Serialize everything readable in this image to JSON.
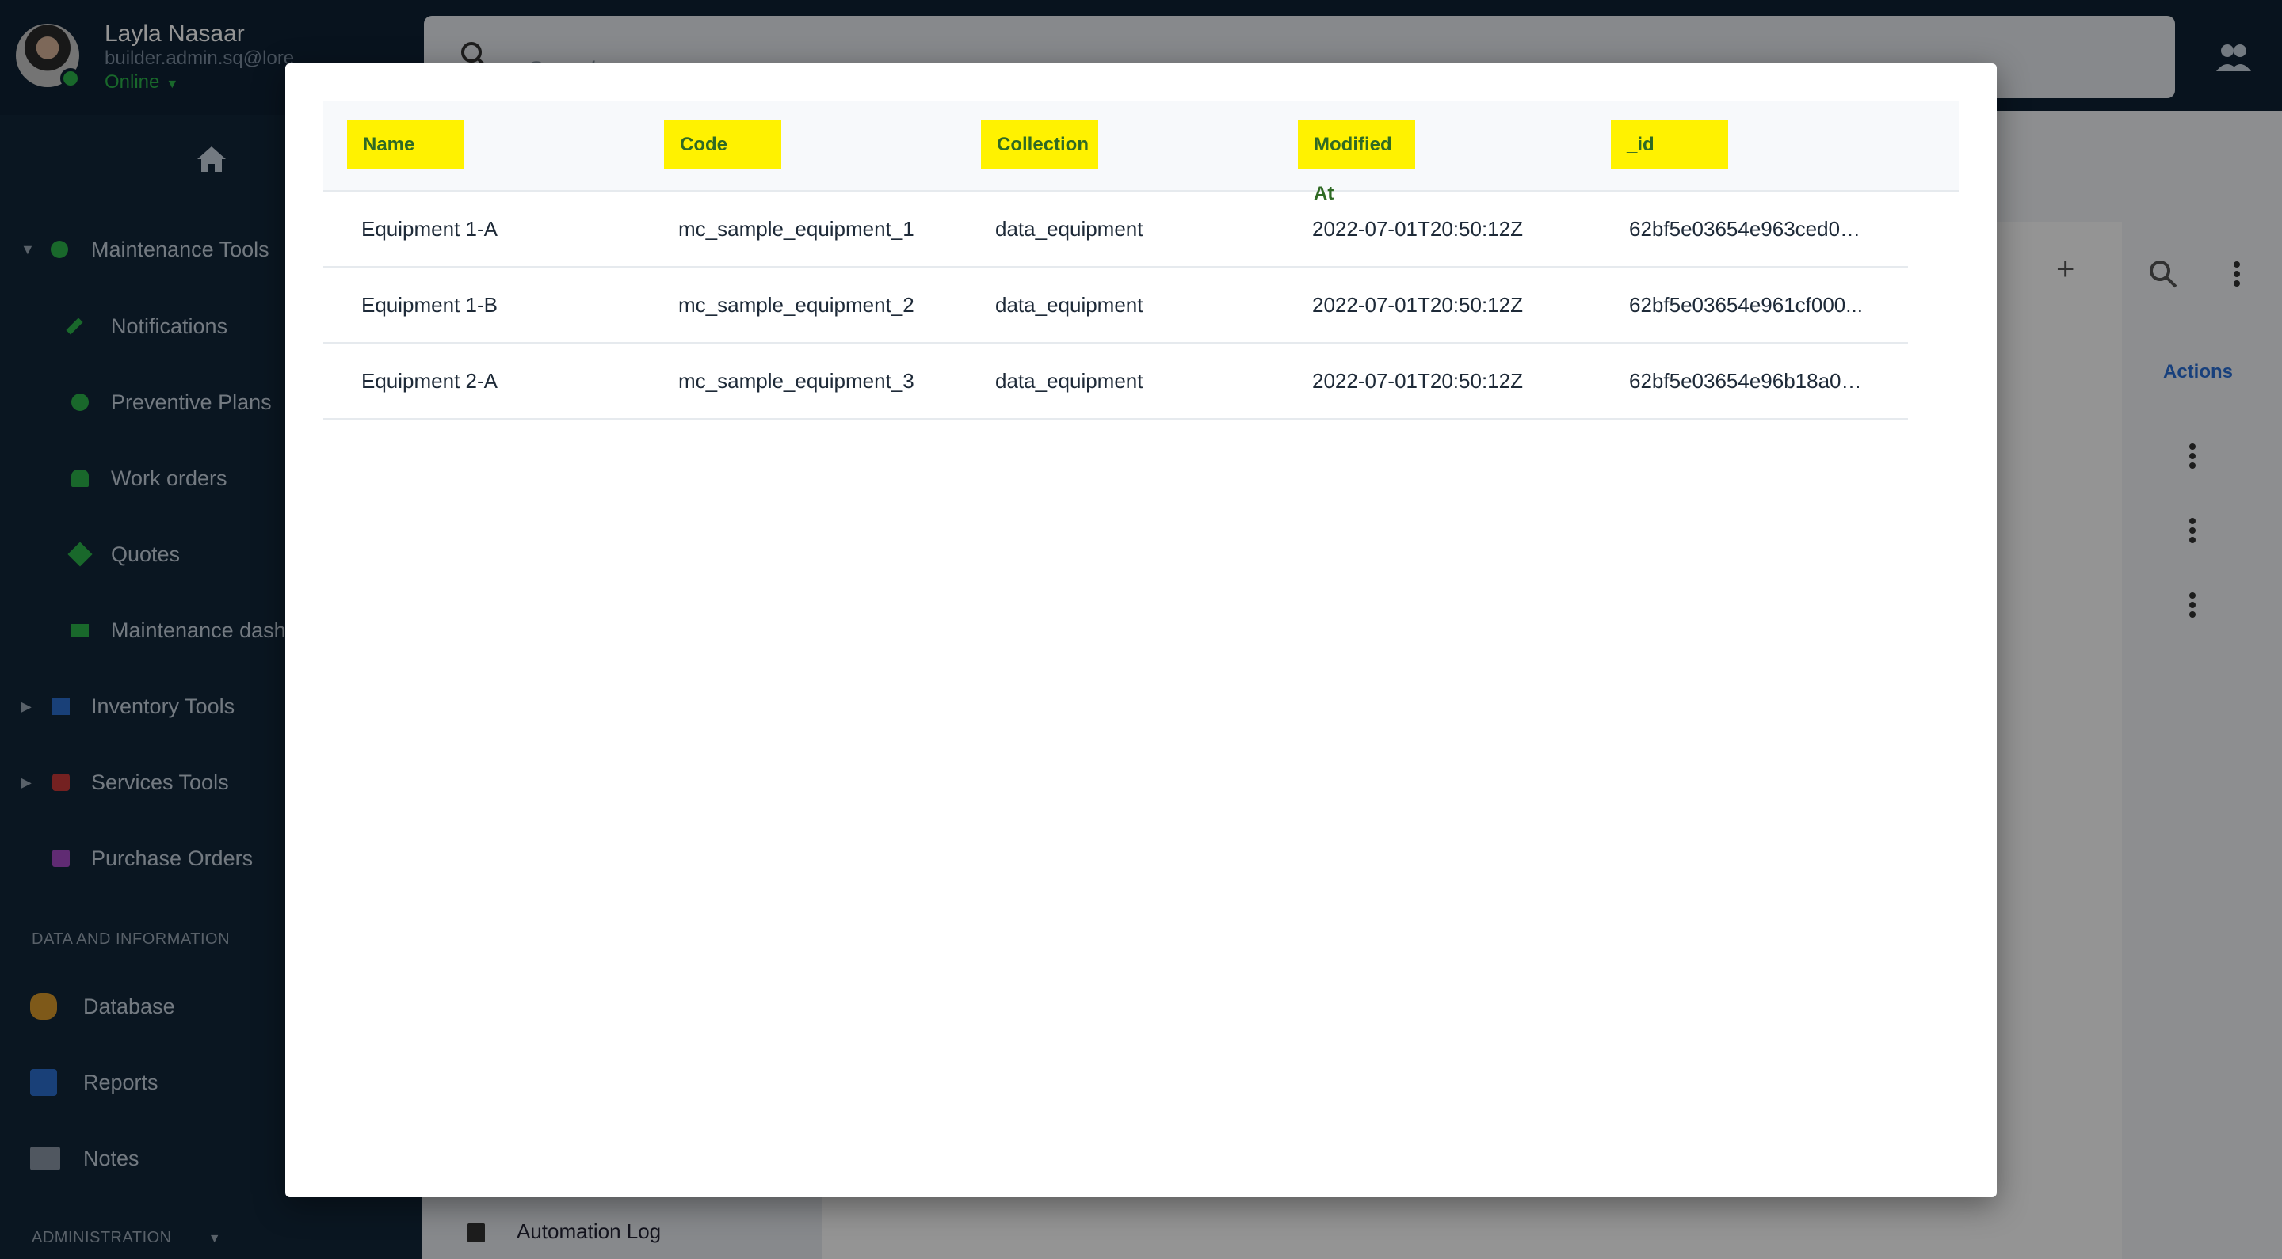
{
  "user": {
    "name": "Layla Nasaar",
    "email": "builder.admin.sq@lore",
    "status": "Online"
  },
  "sidebar": {
    "groups": [
      {
        "label": "Maintenance Tools",
        "items": [
          {
            "label": "Notifications"
          },
          {
            "label": "Preventive Plans"
          },
          {
            "label": "Work orders"
          },
          {
            "label": "Quotes"
          },
          {
            "label": "Maintenance dashb"
          }
        ]
      },
      {
        "label": "Inventory Tools"
      },
      {
        "label": "Services Tools"
      },
      {
        "label": "Purchase Orders"
      }
    ],
    "section_data": "DATA AND INFORMATION",
    "data_items": [
      {
        "label": "Database"
      },
      {
        "label": "Reports"
      },
      {
        "label": "Notes"
      }
    ],
    "section_admin": "ADMINISTRATION"
  },
  "search": {
    "placeholder": "Search"
  },
  "background": {
    "actions_header": "Actions",
    "automation_log": "Automation Log"
  },
  "modal": {
    "columns": [
      "Name",
      "Code",
      "Collection",
      "Modified At",
      "_id"
    ],
    "rows": [
      {
        "name": "Equipment 1-A",
        "code": "mc_sample_equipment_1",
        "collection": "data_equipment",
        "modified_at": "2022-07-01T20:50:12Z",
        "id": "62bf5e03654e963ced00..."
      },
      {
        "name": "Equipment 1-B",
        "code": "mc_sample_equipment_2",
        "collection": "data_equipment",
        "modified_at": "2022-07-01T20:50:12Z",
        "id": "62bf5e03654e961cf000..."
      },
      {
        "name": "Equipment 2-A",
        "code": "mc_sample_equipment_3",
        "collection": "data_equipment",
        "modified_at": "2022-07-01T20:50:12Z",
        "id": "62bf5e03654e96b18a00..."
      }
    ]
  },
  "colors": {
    "header_highlight": "#fff200",
    "header_text": "#2f6a24",
    "sidebar_bg": "#12263a",
    "status_green": "#2bb34a",
    "link_blue": "#2a6fd6"
  }
}
